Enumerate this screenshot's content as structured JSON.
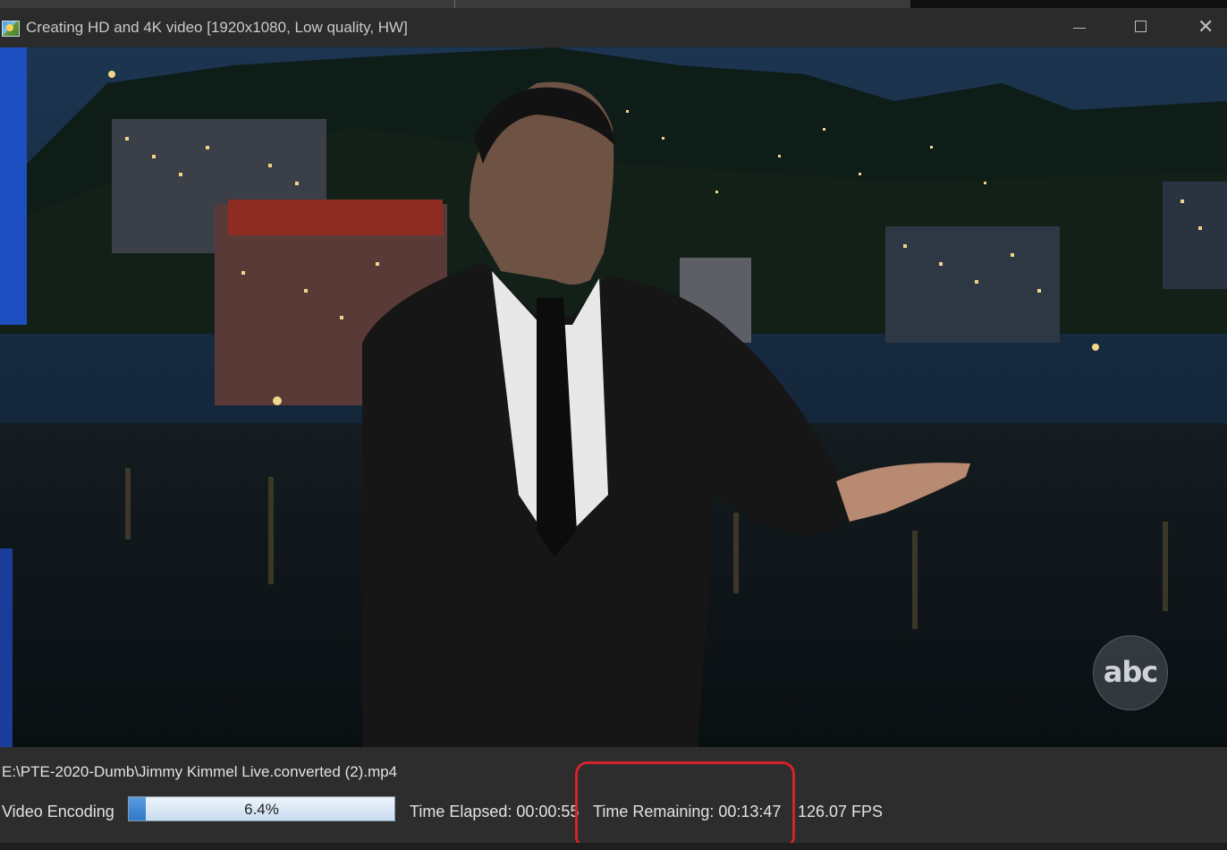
{
  "window": {
    "title": "Creating HD and 4K video [1920x1080, Low quality, HW]",
    "icon": "app-icon"
  },
  "video": {
    "overlay_logo": "abc"
  },
  "status": {
    "file_path": "E:\\PTE-2020-Dumb\\Jimmy Kimmel Live.converted (2).mp4",
    "stage": "Video Encoding",
    "progress_percent": 6.4,
    "progress_label": "6.4%",
    "time_elapsed": "Time Elapsed: 00:00:55",
    "time_remaining": "Time Remaining: 00:13:47",
    "fps": "126.07 FPS"
  },
  "colors": {
    "highlight": "#d3222b",
    "progress_fill": "#2f78c8",
    "background": "#2b2b2b"
  }
}
